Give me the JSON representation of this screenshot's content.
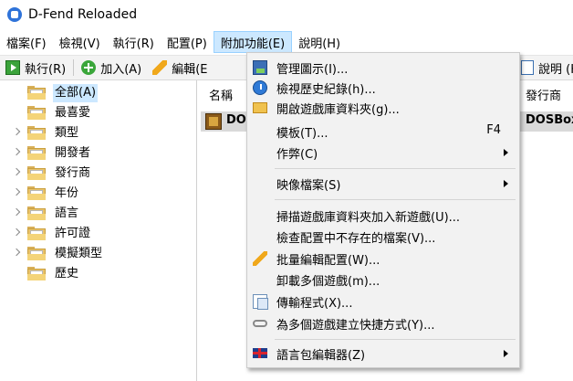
{
  "window": {
    "title": "D-Fend Reloaded"
  },
  "menubar": {
    "items": [
      "檔案(F)",
      "檢視(V)",
      "執行(R)",
      "配置(P)",
      "附加功能(E)",
      "說明(H)"
    ]
  },
  "toolbar": {
    "run": "執行(R)",
    "add": "加入(A)",
    "edit": "編輯(E",
    "help": "說明 (H"
  },
  "tree": {
    "items": [
      "全部(A)",
      "最喜愛",
      "類型",
      "開發者",
      "發行商",
      "年份",
      "語言",
      "許可證",
      "模擬類型",
      "歷史"
    ]
  },
  "list": {
    "headers": {
      "name": "名稱",
      "publisher": "發行商"
    },
    "row": {
      "name": "DO",
      "publisher": "DOSBox"
    }
  },
  "dropdown": {
    "items": [
      {
        "label": "管理圖示(I)...",
        "icon": "picture-icon"
      },
      {
        "label": "檢視歷史紀錄(h)...",
        "icon": "history-icon"
      },
      {
        "label": "開啟遊戲庫資料夾(g)...",
        "icon": "folder-icon"
      },
      {
        "label": "模板(T)...",
        "shortcut": "F4"
      },
      {
        "label": "作弊(C)",
        "submenu": true
      },
      {
        "label": "映像檔案(S)",
        "submenu": true
      },
      {
        "label": "掃描遊戲庫資料夾加入新遊戲(U)..."
      },
      {
        "label": "檢查配置中不存在的檔案(V)..."
      },
      {
        "label": "批量編輯配置(W)...",
        "icon": "pencil-icon"
      },
      {
        "label": "卸載多個遊戲(m)..."
      },
      {
        "label": "傳輸程式(X)...",
        "icon": "document-icon"
      },
      {
        "label": "為多個遊戲建立快捷方式(Y)...",
        "icon": "shortcut-link-icon"
      },
      {
        "label": "語言包編輯器(Z)",
        "icon": "uk-flag-icon",
        "submenu": true
      }
    ]
  },
  "colors": {
    "menu_highlight": "#cce8ff",
    "annotation_marker": "#ff16c8"
  }
}
